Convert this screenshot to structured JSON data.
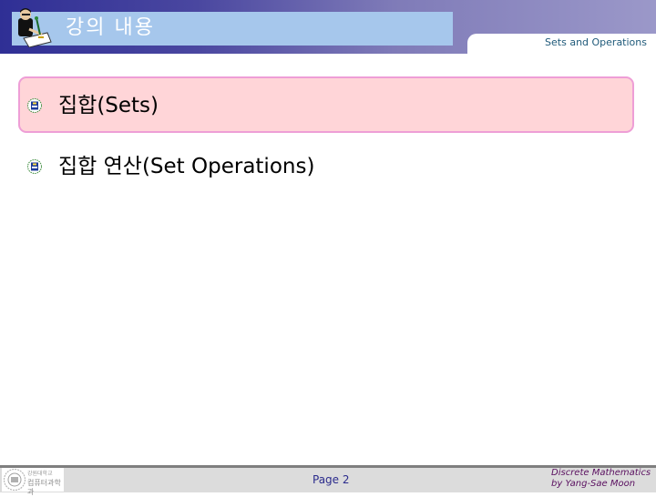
{
  "header": {
    "title": "강의 내용",
    "section_label": "Sets and Operations",
    "icons": {
      "title_icon": "teacher-writing-icon"
    }
  },
  "content": {
    "items": [
      {
        "label": "집합(Sets)",
        "icon": "university-emblem-bullet-icon",
        "highlighted": true
      },
      {
        "label": "집합 연산(Set Operations)",
        "icon": "university-emblem-bullet-icon",
        "highlighted": false
      }
    ]
  },
  "footer": {
    "logo_text_line1": "강원대학교",
    "logo_text_line2": "컴퓨터과학과",
    "page_label": "Page 2",
    "credit_line1": "Discrete Mathematics",
    "credit_line2": "by Yang-Sae Moon"
  },
  "colors": {
    "header_gradient_start": "#2f2f95",
    "header_gradient_end": "#9b98c9",
    "title_bar": "#a6c7ec",
    "highlight_fill": "#ffd5d8",
    "highlight_border": "#ee9ed6",
    "footer_bg": "#dcdcdc",
    "section_label": "#1f5a7a",
    "credit_text": "#5a1060"
  }
}
